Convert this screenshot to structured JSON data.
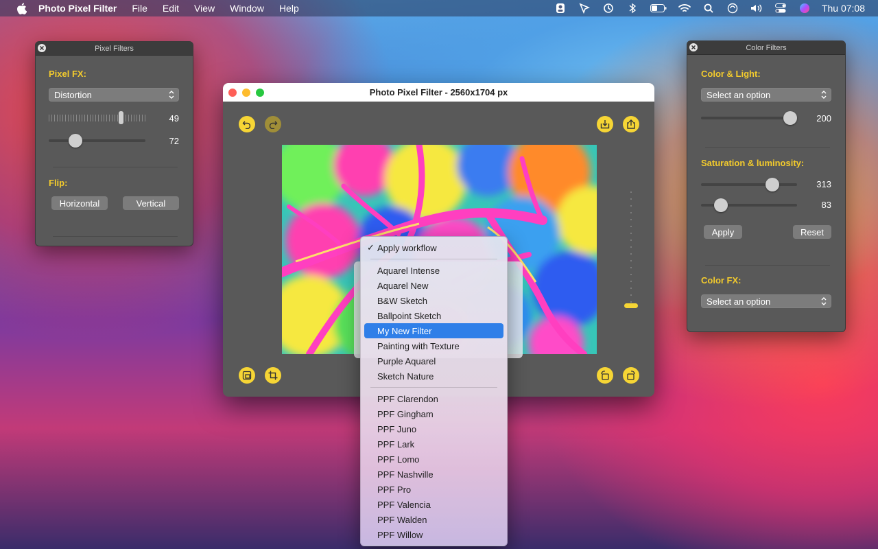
{
  "menubar": {
    "app_name": "Photo Pixel Filter",
    "items": [
      "File",
      "Edit",
      "View",
      "Window",
      "Help"
    ],
    "clock": "Thu 07:08"
  },
  "pixel_panel": {
    "title": "Pixel Filters",
    "fx_label": "Pixel FX:",
    "fx_value": "Distortion",
    "slider1_value": "49",
    "slider2_value": "72",
    "flip_label": "Flip:",
    "horizontal_label": "Horizontal",
    "vertical_label": "Vertical"
  },
  "color_panel": {
    "title": "Color Filters",
    "color_light_label": "Color & Light:",
    "color_light_placeholder": "Select an option",
    "color_light_value": "200",
    "sat_label": "Saturation & luminosity:",
    "saturation_value": "313",
    "luminosity_value": "83",
    "apply_label": "Apply",
    "reset_label": "Reset",
    "color_fx_label": "Color FX:",
    "color_fx_placeholder": "Select an option"
  },
  "main_window": {
    "title": "Photo Pixel Filter - 2560x1704 px"
  },
  "workflow_menu": {
    "checked_item": "Apply workflow",
    "group1": [
      "Aquarel Intense",
      "Aquarel New",
      "B&W Sketch",
      "Ballpoint Sketch",
      "My New Filter",
      "Painting with Texture",
      "Purple Aquarel",
      "Sketch Nature"
    ],
    "selected": "My New Filter",
    "group2": [
      "PPF Clarendon",
      "PPF Gingham",
      "PPF Juno",
      "PPF Lark",
      "PPF Lomo",
      "PPF Nashville",
      "PPF Pro",
      "PPF Valencia",
      "PPF Walden",
      "PPF Willow"
    ]
  },
  "colors": {
    "accent_yellow": "#f6d535",
    "panel_gray": "#595959",
    "selection_blue": "#2f7fe8"
  }
}
